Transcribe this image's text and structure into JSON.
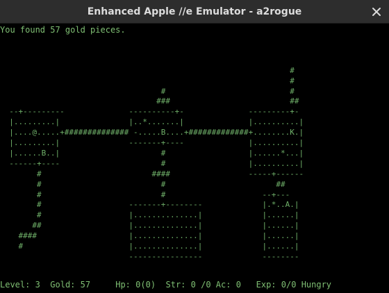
{
  "window": {
    "title": "Enhanced Apple //e Emulator - a2rogue"
  },
  "game": {
    "message": "You found 57 gold pieces.",
    "map_rows": [
      "",
      "",
      "",
      "                                                               #",
      "                                                               #",
      "                                   #                           #",
      "                                  ###                          ##",
      "  --+---------              ----------+-              ---------+-",
      "  |.........|               |..*.......|              |..........|",
      "  |....@.....+############## -.....B....+#############+........K.|",
      "  |.........|               -------+----              |..........|",
      "  |......B..|                      #                  |......*...|",
      "  ------+----                      #                  |..........|",
      "        #                        ####                 -----+------",
      "        #                          #                        ##",
      "        #                          #                     --+---",
      "        #                   -------+--------             |.*..A.|",
      "        #                   |..............|             |......|",
      "       ##                   |..............|             |......|",
      "    ####                    |..............|             |......|",
      "    #                       |..............|             |......|",
      "                            ----------------             --------"
    ],
    "status": {
      "level_label": "Level:",
      "level": "3",
      "gold_label": "Gold:",
      "gold": "57",
      "hp_label": "Hp:",
      "hp": "0(0)",
      "str_label": "Str:",
      "str": "0 /0",
      "ac_label": "Ac:",
      "ac": "0",
      "exp_label": "Exp:",
      "exp": "0/0",
      "hunger": "Hungry"
    }
  },
  "icons": {
    "close": "close-icon"
  },
  "colors": {
    "text": "#7fbf73",
    "titlebar": "#2d2d2d"
  }
}
